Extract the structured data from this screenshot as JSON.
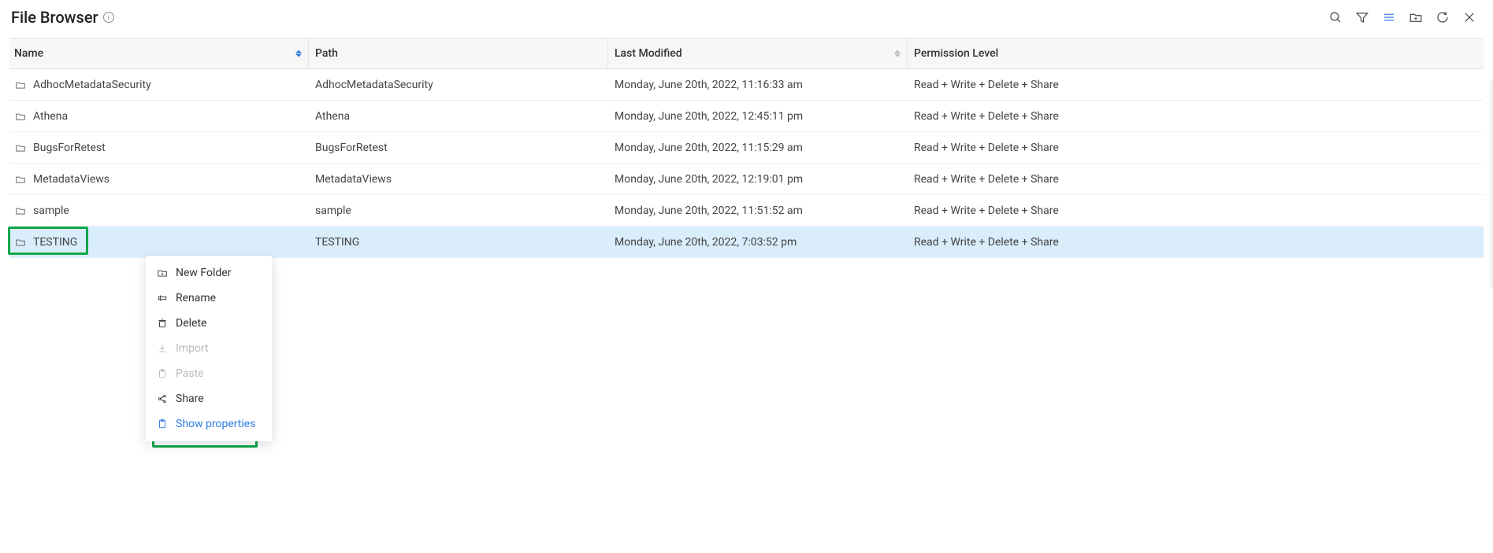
{
  "header": {
    "title": "File Browser"
  },
  "columns": {
    "name": "Name",
    "path": "Path",
    "modified": "Last Modified",
    "permission": "Permission Level"
  },
  "rows": [
    {
      "name": "AdhocMetadataSecurity",
      "path": "AdhocMetadataSecurity",
      "modified": "Monday, June 20th, 2022, 11:16:33 am",
      "permission": "Read + Write + Delete + Share",
      "selected": false
    },
    {
      "name": "Athena",
      "path": "Athena",
      "modified": "Monday, June 20th, 2022, 12:45:11 pm",
      "permission": "Read + Write + Delete + Share",
      "selected": false
    },
    {
      "name": "BugsForRetest",
      "path": "BugsForRetest",
      "modified": "Monday, June 20th, 2022, 11:15:29 am",
      "permission": "Read + Write + Delete + Share",
      "selected": false
    },
    {
      "name": "MetadataViews",
      "path": "MetadataViews",
      "modified": "Monday, June 20th, 2022, 12:19:01 pm",
      "permission": "Read + Write + Delete + Share",
      "selected": false
    },
    {
      "name": "sample",
      "path": "sample",
      "modified": "Monday, June 20th, 2022, 11:51:52 am",
      "permission": "Read + Write + Delete + Share",
      "selected": false
    },
    {
      "name": "TESTING",
      "path": "TESTING",
      "modified": "Monday, June 20th, 2022, 7:03:52 pm",
      "permission": "Read + Write + Delete + Share",
      "selected": true
    }
  ],
  "context_menu": [
    {
      "label": "New Folder",
      "icon": "new-folder-icon",
      "disabled": false,
      "active": false
    },
    {
      "label": "Rename",
      "icon": "rename-icon",
      "disabled": false,
      "active": false
    },
    {
      "label": "Delete",
      "icon": "delete-icon",
      "disabled": false,
      "active": false
    },
    {
      "label": "Import",
      "icon": "import-icon",
      "disabled": true,
      "active": false
    },
    {
      "label": "Paste",
      "icon": "paste-icon",
      "disabled": true,
      "active": false
    },
    {
      "label": "Share",
      "icon": "share-icon",
      "disabled": false,
      "active": false
    },
    {
      "label": "Show properties",
      "icon": "properties-icon",
      "disabled": false,
      "active": true
    }
  ]
}
